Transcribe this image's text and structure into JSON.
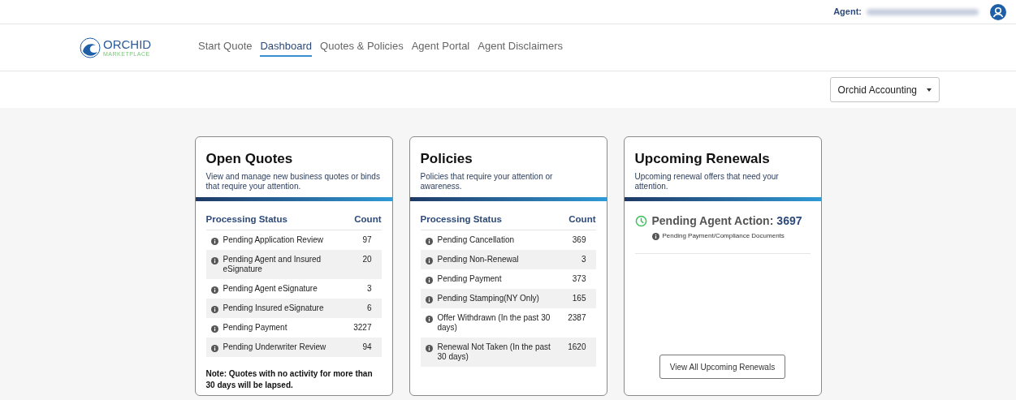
{
  "top_bar": {
    "agent_label": "Agent:"
  },
  "logo": {
    "name": "ORCHID",
    "tagline": "MARKETPLACE"
  },
  "nav": [
    {
      "label": "Start Quote",
      "selected": false
    },
    {
      "label": "Dashboard",
      "selected": true
    },
    {
      "label": "Quotes & Policies",
      "selected": false
    },
    {
      "label": "Agent Portal",
      "selected": false
    },
    {
      "label": "Agent Disclaimers",
      "selected": false
    }
  ],
  "agency_select": {
    "value": "Orchid Accounting"
  },
  "cards": [
    {
      "kind": "table",
      "title": "Open Quotes",
      "description": "View and manage new business quotes or binds that require your attention.",
      "columns": [
        "Processing Status",
        "Count"
      ],
      "rows": [
        {
          "status": "Pending Application Review",
          "count": "97"
        },
        {
          "status": "Pending Agent and Insured eSignature",
          "count": "20"
        },
        {
          "status": "Pending Agent eSignature",
          "count": "3"
        },
        {
          "status": "Pending Insured eSignature",
          "count": "6"
        },
        {
          "status": "Pending Payment",
          "count": "3227"
        },
        {
          "status": "Pending Underwriter Review",
          "count": "94"
        }
      ],
      "note": "Note: Quotes with no activity for more than 30 days will be lapsed."
    },
    {
      "kind": "table",
      "title": "Policies",
      "description": "Policies that require your attention or awareness.",
      "columns": [
        "Processing Status",
        "Count"
      ],
      "rows": [
        {
          "status": "Pending Cancellation",
          "count": "369"
        },
        {
          "status": "Pending Non-Renewal",
          "count": "3"
        },
        {
          "status": "Pending Payment",
          "count": "373"
        },
        {
          "status": "Pending Stamping(NY Only)",
          "count": "165"
        },
        {
          "status": "Offer Withdrawn (In the past 30 days)",
          "count": "2387"
        },
        {
          "status": "Renewal Not Taken (In the past 30 days)",
          "count": "1620"
        }
      ]
    },
    {
      "kind": "summary",
      "title": "Upcoming Renewals",
      "description": "Upcoming renewal offers that need your attention.",
      "summary_label": "Pending Agent Action:",
      "summary_value": "3697",
      "summary_detail": "Pending Payment/Compliance Documents",
      "button": "View All Upcoming Renewals"
    }
  ]
}
